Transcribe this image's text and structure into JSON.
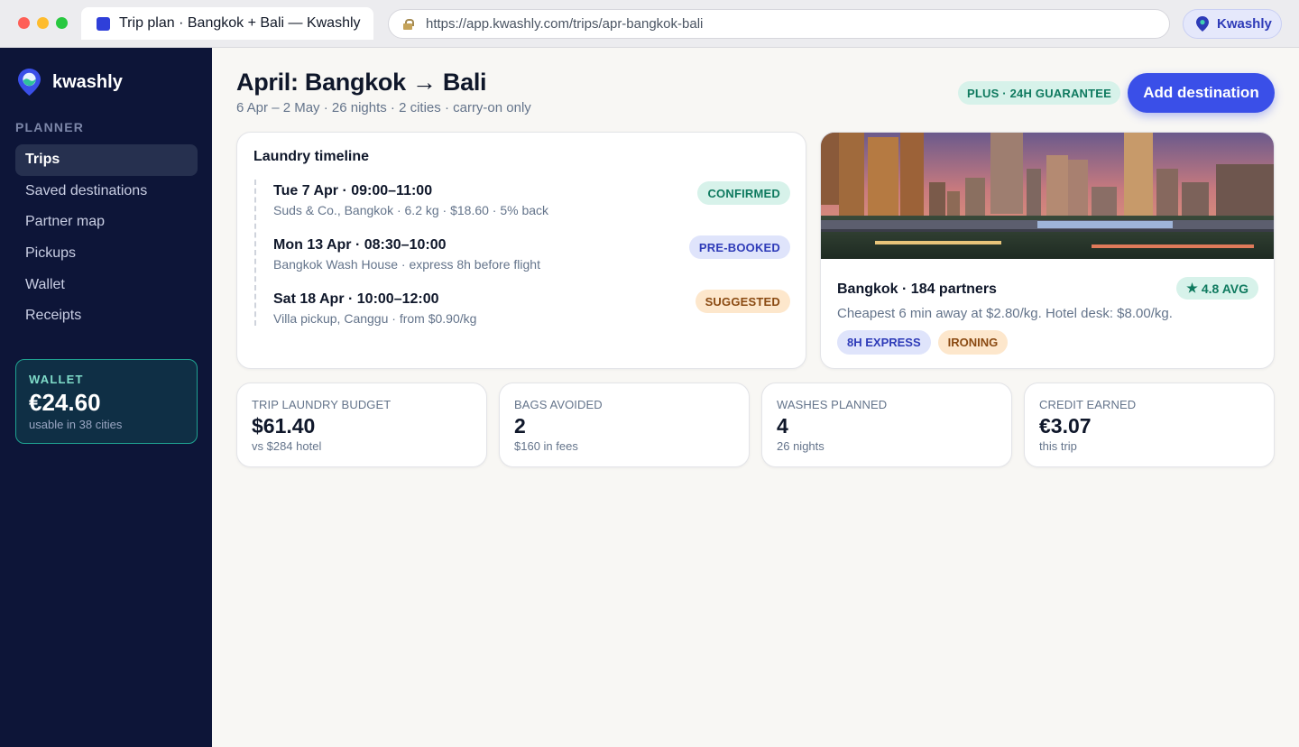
{
  "browser": {
    "tab_title": "Trip plan · Bangkok + Bali — Kwashly",
    "url": "https://app.kwashly.com/trips/apr-bangkok-bali",
    "profile_label": "Kwashly"
  },
  "sidebar": {
    "brand": "kwashly",
    "section_label": "PLANNER",
    "items": [
      {
        "label": "Trips",
        "active": true
      },
      {
        "label": "Saved destinations"
      },
      {
        "label": "Partner map"
      },
      {
        "label": "Pickups"
      },
      {
        "label": "Wallet"
      },
      {
        "label": "Receipts"
      }
    ],
    "wallet": {
      "label": "WALLET",
      "amount": "€24.60",
      "sub": "usable in 38 cities"
    }
  },
  "header": {
    "title": "April: Bangkok → Bali",
    "subtitle": "6 Apr – 2 May · 26 nights · 2 cities · carry-on only",
    "guarantee_badge": "PLUS · 24H GUARANTEE",
    "add_button": "Add destination"
  },
  "timeline": {
    "title": "Laundry timeline",
    "entries": [
      {
        "when": "Tue 7 Apr · 09:00–11:00",
        "detail": "Suds & Co., Bangkok · 6.2 kg · $18.60 · 5% back",
        "status": "CONFIRMED"
      },
      {
        "when": "Mon 13 Apr · 08:30–10:00",
        "detail": "Bangkok Wash House · express 8h before flight",
        "status": "PRE-BOOKED"
      },
      {
        "when": "Sat 18 Apr · 10:00–12:00",
        "detail": "Villa pickup, Canggu · from $0.90/kg",
        "status": "SUGGESTED"
      }
    ]
  },
  "city": {
    "name": "Bangkok · 184 partners",
    "rating": "4.8 AVG",
    "description": "Cheapest 6 min away at $2.80/kg. Hotel desk: $8.00/kg.",
    "tags": [
      "8H EXPRESS",
      "IRONING"
    ]
  },
  "stats": [
    {
      "label": "TRIP LAUNDRY BUDGET",
      "value": "$61.40",
      "sub": "vs $284 hotel"
    },
    {
      "label": "BAGS AVOIDED",
      "value": "2",
      "sub": "$160 in fees"
    },
    {
      "label": "WASHES PLANNED",
      "value": "4",
      "sub": "26 nights"
    },
    {
      "label": "CREDIT EARNED",
      "value": "€3.07",
      "sub": "this trip"
    }
  ],
  "colors": {
    "sidebar_bg": "#0d1538",
    "accent": "#3a4fe8",
    "success": "#0f7a5f",
    "warning": "#8a4a12"
  },
  "icons": {
    "brand": "map-pin-icon",
    "lock": "lock-icon",
    "rating": "star-icon"
  }
}
